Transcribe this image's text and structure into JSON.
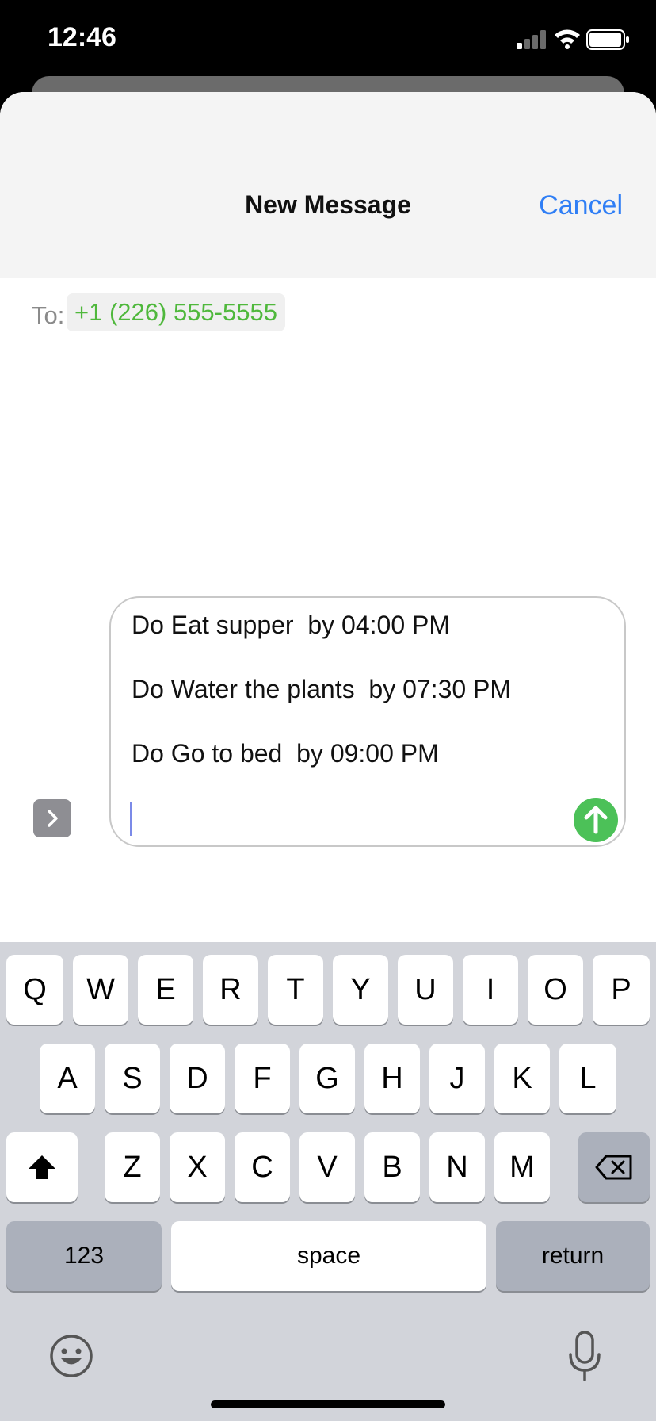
{
  "status": {
    "time": "12:46"
  },
  "nav": {
    "title": "New Message",
    "cancel_label": "Cancel"
  },
  "to": {
    "label": "To:",
    "recipient": "+1 (226) 555-5555"
  },
  "message": {
    "lines": [
      "Do Eat supper  by 04:00 PM",
      "Do Water the plants  by 07:30 PM",
      "Do Go to bed  by 09:00 PM"
    ]
  },
  "keyboard": {
    "row1": [
      "Q",
      "W",
      "E",
      "R",
      "T",
      "Y",
      "U",
      "I",
      "O",
      "P"
    ],
    "row2": [
      "A",
      "S",
      "D",
      "F",
      "G",
      "H",
      "J",
      "K",
      "L"
    ],
    "row3": [
      "Z",
      "X",
      "C",
      "V",
      "B",
      "N",
      "M"
    ],
    "numbers_label": "123",
    "space_label": "space",
    "return_label": "return"
  },
  "icons": [
    "signal-icon",
    "wifi-icon",
    "battery-icon",
    "chevron-right-icon",
    "send-arrow-icon",
    "shift-icon",
    "delete-icon",
    "emoji-icon",
    "microphone-icon"
  ],
  "colors": {
    "accent": "#2f7ef5",
    "recipient": "#4fb83c",
    "send": "#4cc158",
    "keyboard_bg": "#d2d4da"
  }
}
